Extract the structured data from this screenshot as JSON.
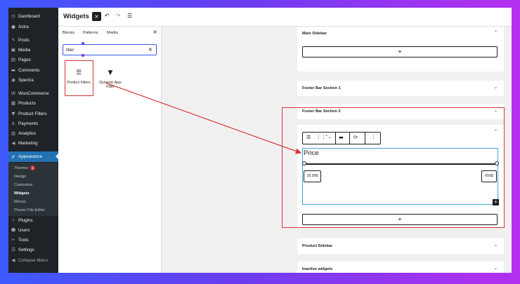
{
  "admin_menu": {
    "items": [
      {
        "label": "Dashboard",
        "icon": "dashboard-icon",
        "glyph": "◷"
      },
      {
        "label": "Astra",
        "icon": "astra-icon",
        "glyph": "●"
      },
      {
        "label": "Posts",
        "icon": "pin-icon",
        "glyph": "✎"
      },
      {
        "label": "Media",
        "icon": "media-icon",
        "glyph": "▣"
      },
      {
        "label": "Pages",
        "icon": "pages-icon",
        "glyph": "▤"
      },
      {
        "label": "Comments",
        "icon": "comment-icon",
        "glyph": "▬"
      },
      {
        "label": "Spectra",
        "icon": "spectra-icon",
        "glyph": "◉"
      },
      {
        "label": "WooCommerce",
        "icon": "woo-icon",
        "glyph": "W"
      },
      {
        "label": "Products",
        "icon": "products-icon",
        "glyph": "▦"
      },
      {
        "label": "Product Filters",
        "icon": "filter-icon",
        "glyph": "▼"
      },
      {
        "label": "Payments",
        "icon": "payments-icon",
        "glyph": "$"
      },
      {
        "label": "Analytics",
        "icon": "analytics-icon",
        "glyph": "▥"
      },
      {
        "label": "Marketing",
        "icon": "megaphone-icon",
        "glyph": "◀"
      },
      {
        "label": "Appearance",
        "icon": "brush-icon",
        "glyph": "✐"
      }
    ],
    "submenu": [
      {
        "label": "Themes",
        "badge": "1"
      },
      {
        "label": "Design"
      },
      {
        "label": "Customize"
      },
      {
        "label": "Widgets"
      },
      {
        "label": "Menus"
      },
      {
        "label": "Theme File Editor"
      }
    ],
    "bottom_items": [
      {
        "label": "Plugins",
        "icon": "plugin-icon",
        "glyph": "⚡"
      },
      {
        "label": "Users",
        "icon": "users-icon",
        "glyph": "☻"
      },
      {
        "label": "Tools",
        "icon": "tools-icon",
        "glyph": "✂"
      },
      {
        "label": "Settings",
        "icon": "settings-icon",
        "glyph": "☰"
      },
      {
        "label": "Collapse Menu",
        "icon": "collapse-icon",
        "glyph": "◀"
      }
    ]
  },
  "topbar": {
    "title": "Widgets",
    "close": "×",
    "undo": "↶",
    "redo": "↷",
    "list_view": "☰"
  },
  "inserter": {
    "tabs": [
      "Blocks",
      "Patterns",
      "Media"
    ],
    "close": "×",
    "search_value": "filter",
    "search_clear": "×",
    "blocks": [
      {
        "label": "Product Filters",
        "glyph": "☰",
        "icon": "filter-lines-icon"
      },
      {
        "label": "Dynamic Ajax Filter",
        "glyph": "▼",
        "icon": "funnel-icon"
      }
    ]
  },
  "widget_areas": [
    {
      "title": "Main Sidebar",
      "chevron": "⌃"
    },
    {
      "title": "Footer Bar Section 1",
      "chevron": "⌄"
    },
    {
      "title": "Footer Bar Section 2",
      "chevron": "⌄"
    },
    {
      "title": "",
      "chevron": "⌃"
    },
    {
      "title": "Product Sidebar",
      "chevron": "⌄"
    },
    {
      "title": "Inactive widgets",
      "chevron": "⌄"
    }
  ],
  "add_block": "+",
  "filter_block": {
    "title": "Price",
    "min_price": "29.99$",
    "max_price": "650$",
    "corner_plus": "+"
  },
  "block_toolbar": {
    "icons": [
      "☰",
      "⋮⋮",
      "⌃⌄",
      "▬",
      "⟳",
      "⋮"
    ]
  },
  "colors": {
    "highlight": "#d63638",
    "accent": "#2271b1",
    "block_border": "#3ea6d8"
  }
}
